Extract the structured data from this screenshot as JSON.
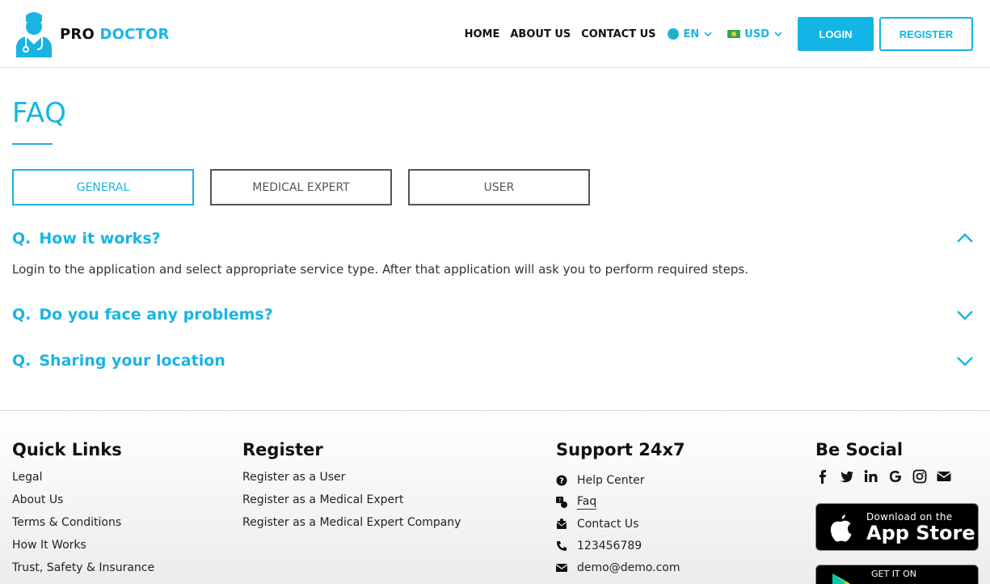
{
  "brand": {
    "pro": "PRO",
    "doctor": "DOCTOR"
  },
  "nav": {
    "home": "HOME",
    "about": "ABOUT US",
    "contact": "CONTACT US",
    "language": "EN",
    "currency": "USD",
    "login": "LOGIN",
    "register": "REGISTER"
  },
  "page": {
    "title": "FAQ"
  },
  "tabs": [
    {
      "label": "GENERAL",
      "active": true
    },
    {
      "label": "MEDICAL EXPERT",
      "active": false
    },
    {
      "label": "USER",
      "active": false
    }
  ],
  "faqs": [
    {
      "prefix": "Q.",
      "question": "How it works?",
      "expanded": true,
      "answer": "Login to the application and select appropriate service type. After that application will ask you to perform required steps."
    },
    {
      "prefix": "Q.",
      "question": "Do you face any problems?",
      "expanded": false
    },
    {
      "prefix": "Q.",
      "question": "Sharing your location",
      "expanded": false
    }
  ],
  "footer": {
    "quick_links": {
      "title": "Quick Links",
      "items": [
        "Legal",
        "About Us",
        "Terms & Conditions",
        "How It Works",
        "Trust, Safety & Insurance"
      ]
    },
    "register": {
      "title": "Register",
      "items": [
        "Register as a User",
        "Register as a Medical Expert",
        "Register as a Medical Expert Company"
      ]
    },
    "support": {
      "title": "Support 24x7",
      "items": [
        {
          "icon": "question-circle-icon",
          "label": "Help Center"
        },
        {
          "icon": "faq-icon",
          "label": "Faq"
        },
        {
          "icon": "contact-icon",
          "label": "Contact Us"
        },
        {
          "icon": "phone-icon",
          "label": "123456789"
        },
        {
          "icon": "envelope-icon",
          "label": "demo@demo.com"
        }
      ]
    },
    "social": {
      "title": "Be Social",
      "icons": [
        "facebook-icon",
        "twitter-icon",
        "linkedin-icon",
        "google-icon",
        "instagram-icon",
        "envelope-icon"
      ],
      "app_store_small": "Download on the",
      "app_store_big": "App Store",
      "google_play_small": "GET IT ON"
    }
  },
  "colors": {
    "accent": "#1ab4e3",
    "text": "#222222"
  }
}
